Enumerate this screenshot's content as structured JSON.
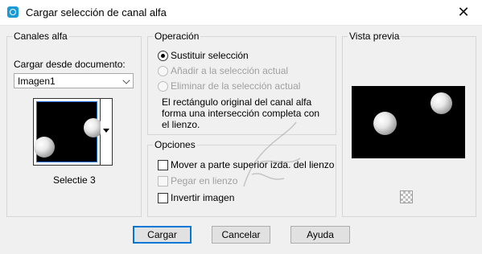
{
  "window": {
    "title": "Cargar selección de canal alfa",
    "close_glyph": "✕"
  },
  "canales": {
    "title": "Canales alfa",
    "load_from_label": "Cargar desde documento:",
    "document_value": "Imagen1",
    "channel_caption": "Selectie 3"
  },
  "operacion": {
    "title": "Operación",
    "options": [
      {
        "label": "Sustituir selección",
        "checked": true,
        "enabled": true
      },
      {
        "label": "Añadir a la selección actual",
        "checked": false,
        "enabled": false
      },
      {
        "label": "Eliminar de la selección actual",
        "checked": false,
        "enabled": false
      }
    ],
    "description_lines": [
      "El rectángulo original del canal alfa",
      "forma una intersección completa con",
      "el lienzo."
    ]
  },
  "opciones": {
    "title": "Opciones",
    "checks": [
      {
        "label": "Mover a parte superior izda. del lienzo",
        "checked": false,
        "enabled": true
      },
      {
        "label": "Pegar en lienzo",
        "checked": false,
        "enabled": false
      },
      {
        "label": "Invertir imagen",
        "checked": false,
        "enabled": true
      }
    ]
  },
  "preview": {
    "title": "Vista previa"
  },
  "buttons": {
    "ok": "Cargar",
    "cancel": "Cancelar",
    "help": "Ayuda"
  },
  "icons": {
    "app": "psp-app-icon",
    "close": "close-icon",
    "dropdown": "chevron-down-icon",
    "transparency": "checkerboard-icon"
  },
  "colors": {
    "window_bg": "#f0f0f0",
    "titlebar_bg": "#ffffff",
    "accent": "#0078d7",
    "disabled_text": "#a0a0a0"
  }
}
